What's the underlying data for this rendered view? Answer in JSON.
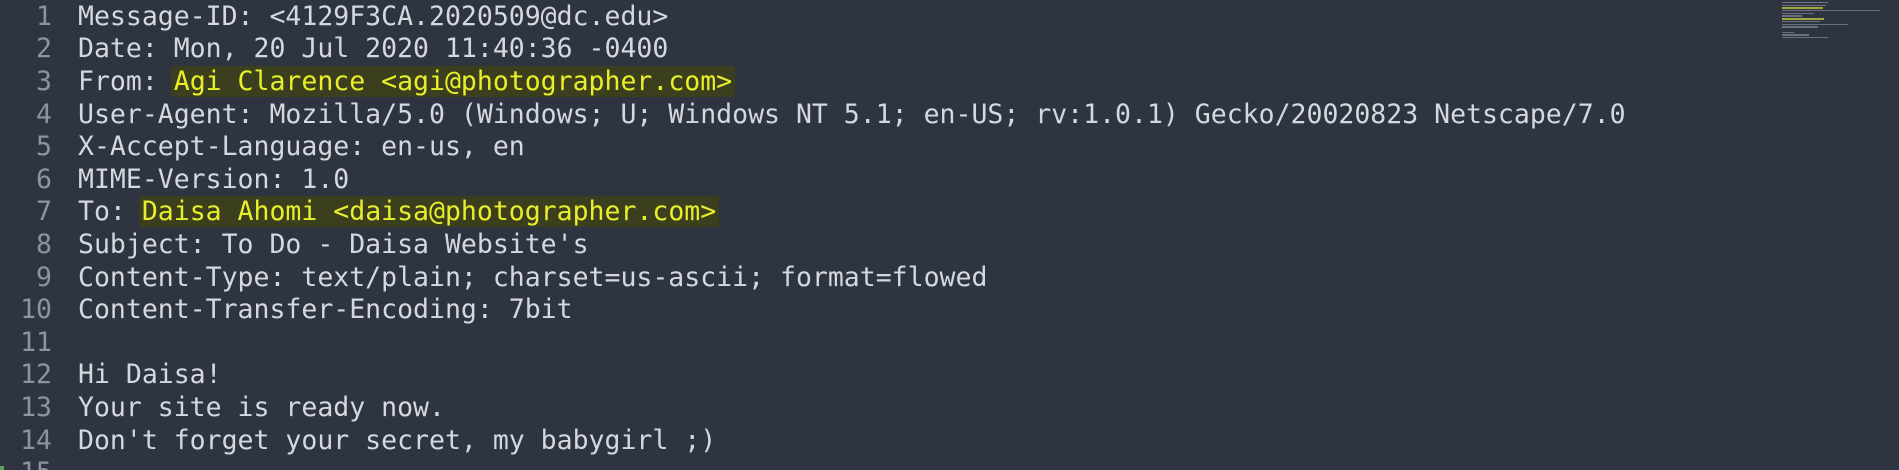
{
  "editor": {
    "lines": [
      {
        "num": "1",
        "text": "Message-ID: <4129F3CA.2020509@dc.edu>"
      },
      {
        "num": "2",
        "text": "Date: Mon, 20 Jul 2020 11:40:36 -0400"
      },
      {
        "num": "3",
        "prefix": "From: ",
        "highlight": "Agi Clarence <agi@photographer.com>"
      },
      {
        "num": "4",
        "text": "User-Agent: Mozilla/5.0 (Windows; U; Windows NT 5.1; en-US; rv:1.0.1) Gecko/20020823 Netscape/7.0"
      },
      {
        "num": "5",
        "text": "X-Accept-Language: en-us, en"
      },
      {
        "num": "6",
        "text": "MIME-Version: 1.0"
      },
      {
        "num": "7",
        "prefix": "To: ",
        "highlight": "Daisa Ahomi <daisa@photographer.com>"
      },
      {
        "num": "8",
        "text": "Subject: To Do - Daisa Website's"
      },
      {
        "num": "9",
        "text": "Content-Type: text/plain; charset=us-ascii; format=flowed"
      },
      {
        "num": "10",
        "text": "Content-Transfer-Encoding: 7bit"
      },
      {
        "num": "11",
        "text": ""
      },
      {
        "num": "12",
        "text": "Hi Daisa!"
      },
      {
        "num": "13",
        "text": "Your site is ready now."
      },
      {
        "num": "14",
        "text": "Don't forget your secret, my babygirl ;)"
      },
      {
        "num": "15",
        "text": ""
      }
    ]
  },
  "colors": {
    "background": "#2e3440",
    "text": "#d4d8df",
    "line_number": "#8f939b",
    "highlight_bg": "#3b3f1e",
    "highlight_fg": "#e8ef2a"
  }
}
